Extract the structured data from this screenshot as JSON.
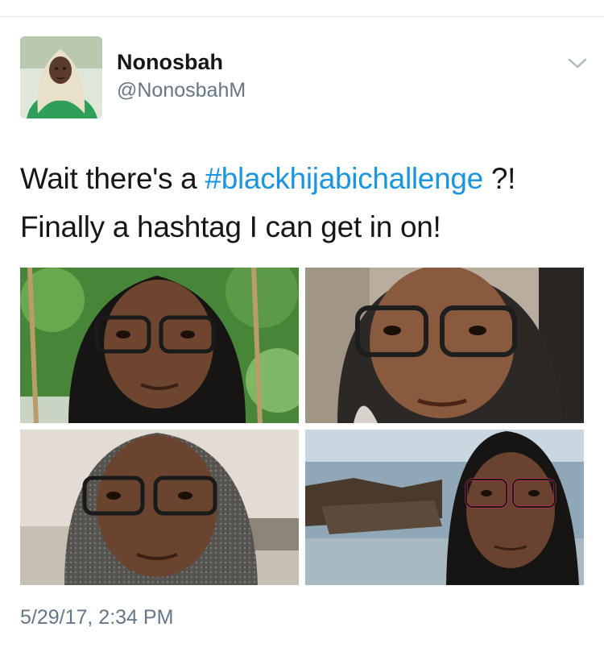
{
  "tweet": {
    "author_name": "Nonosbah",
    "author_handle": "@NonosbahM",
    "text_before": "Wait there's a ",
    "hashtag": "#blackhijabichallenge",
    "text_after": " ?! Finally a hashtag I can get in on!",
    "timestamp": "5/29/17, 2:34 PM"
  },
  "icons": {
    "menu": "chevron-down-icon"
  },
  "colors": {
    "hashtag": "#1b95e0",
    "secondary_text": "#657786",
    "primary_text": "#14171a",
    "divider": "#e1e8ed"
  },
  "photos": [
    {
      "subject": "selfie with glasses and black hijab, greenery and chain swing behind"
    },
    {
      "subject": "selfie with glasses and black hijab, car interior behind"
    },
    {
      "subject": "selfie with glasses and black hijab, outdoor wall behind"
    },
    {
      "subject": "selfie with glasses and black hijab, rocky seashore behind"
    }
  ]
}
